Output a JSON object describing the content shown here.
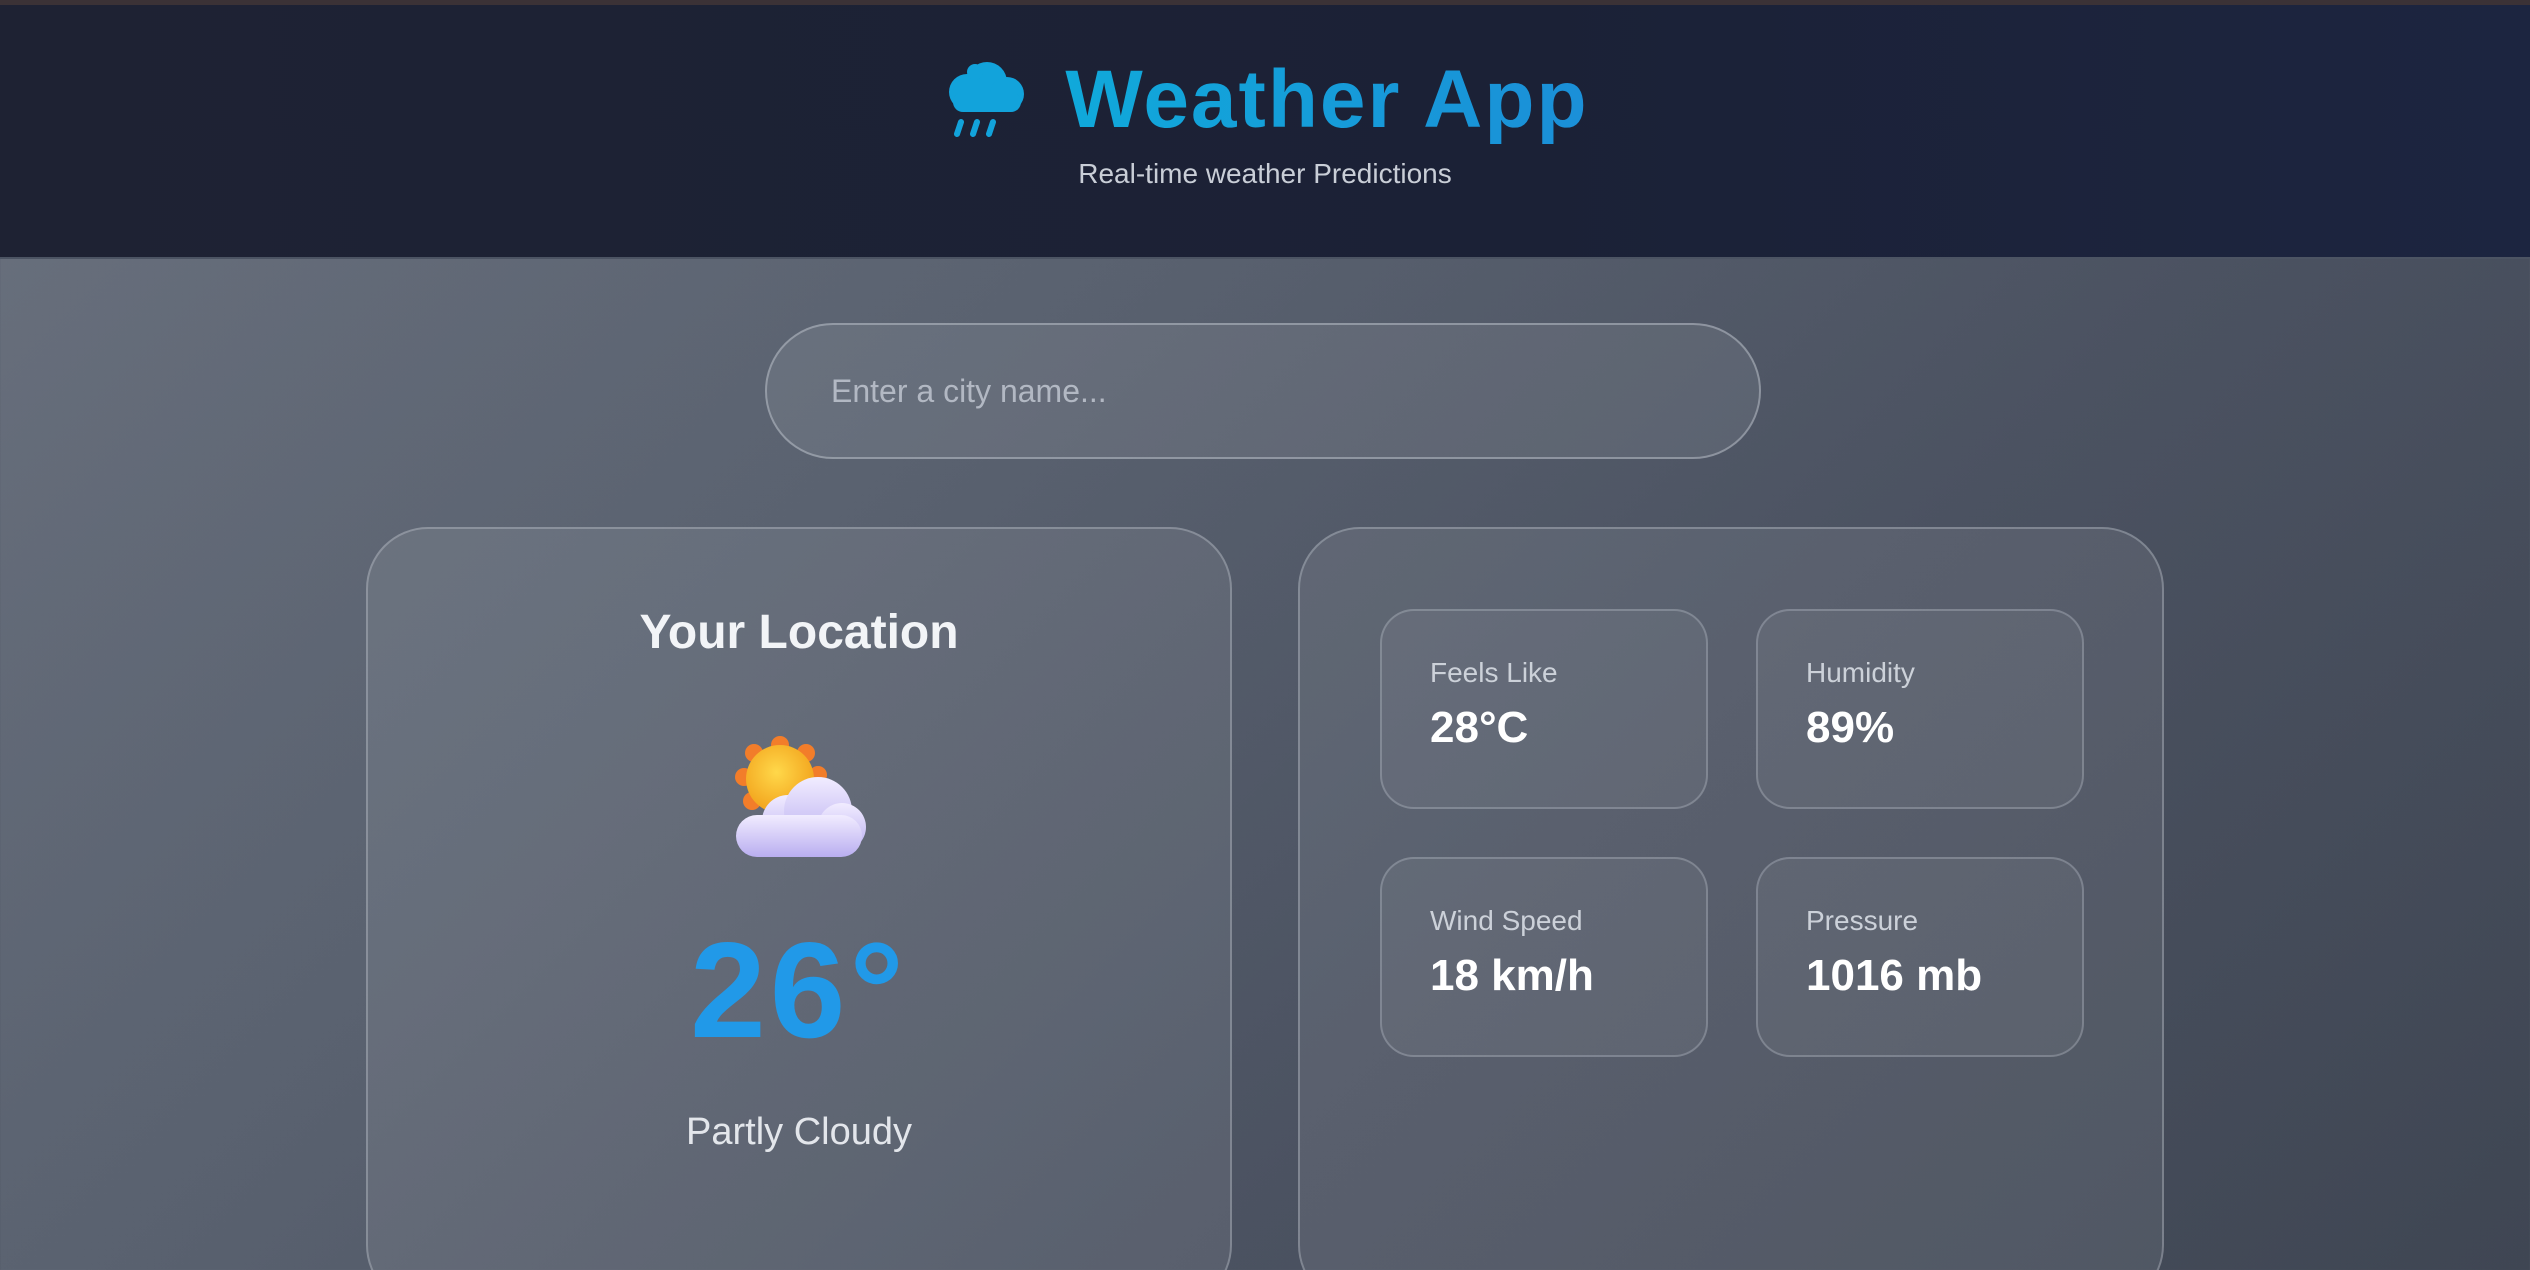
{
  "header": {
    "title": "Weather App",
    "subtitle": "Real-time weather Predictions",
    "icon": "cloud-rain-icon"
  },
  "search": {
    "placeholder": "Enter a city name...",
    "value": ""
  },
  "current": {
    "location": "Your Location",
    "icon": "partly-cloudy-icon",
    "temperature": "26°",
    "condition": "Partly Cloudy"
  },
  "details": [
    {
      "label": "Feels Like",
      "value": "28°C"
    },
    {
      "label": "Humidity",
      "value": "89%"
    },
    {
      "label": "Wind Speed",
      "value": "18 km/h"
    },
    {
      "label": "Pressure",
      "value": "1016 mb"
    }
  ],
  "colors": {
    "accent": "#12a3db",
    "temperature": "#2199e8",
    "header_bg": "#1e2233"
  }
}
